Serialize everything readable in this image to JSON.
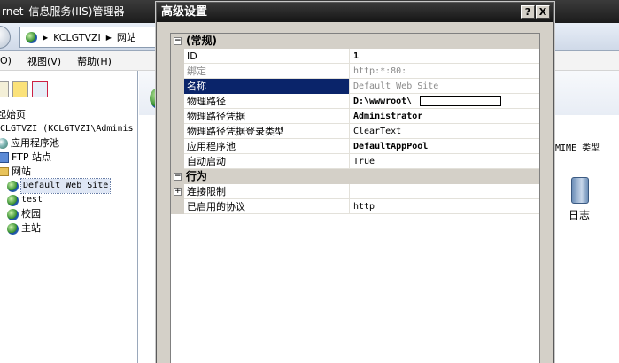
{
  "iis": {
    "title_left": "rnet",
    "title": "信息服务(IIS)管理器",
    "breadcrumb": [
      "KCLGTVZI",
      "网站"
    ],
    "menu": [
      "O)",
      "视图(V)",
      "帮助(H)"
    ],
    "tree": [
      {
        "label": "起始页"
      },
      {
        "label": "KCLGTVZI (KCLGTVZI\\Adminis"
      },
      {
        "label": "应用程序池"
      },
      {
        "label": "FTP 站点"
      },
      {
        "label": "网站"
      },
      {
        "label": "Default Web Site"
      },
      {
        "label": "test"
      },
      {
        "label": "校园"
      },
      {
        "label": "主站"
      }
    ],
    "mime_label": "MIME 类型",
    "log_label": "日志"
  },
  "dialog": {
    "title": "高级设置",
    "help_label": "?",
    "close_label": "X",
    "categories": {
      "general": "(常规)",
      "behavior": "行为"
    },
    "general_props": [
      {
        "name": "ID",
        "value": "1"
      },
      {
        "name": "绑定",
        "value": "http:*:80:"
      },
      {
        "name": "名称",
        "value": "Default Web Site"
      },
      {
        "name": "物理路径",
        "value": "D:\\wwwroot\\"
      },
      {
        "name": "物理路径凭据",
        "value": "Administrator"
      },
      {
        "name": "物理路径凭据登录类型",
        "value": "ClearText"
      },
      {
        "name": "应用程序池",
        "value": "DefaultAppPool"
      },
      {
        "name": "自动启动",
        "value": "True"
      }
    ],
    "behavior_props": [
      {
        "name": "连接限制",
        "value": ""
      },
      {
        "name": "已启用的协议",
        "value": "http"
      }
    ],
    "toggle_collapse": "−",
    "toggle_expand": "+"
  }
}
